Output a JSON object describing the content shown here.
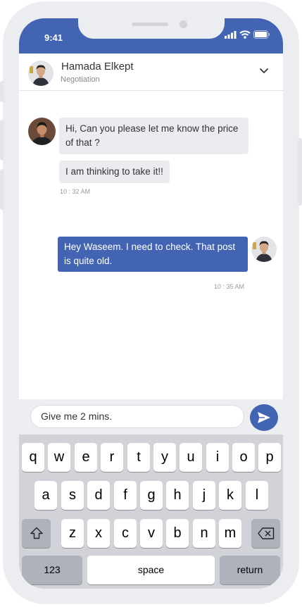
{
  "status_bar": {
    "time": "9:41"
  },
  "header": {
    "contact_name": "Hamada Elkept",
    "subtitle": "Negotiation"
  },
  "messages": [
    {
      "text": "Hi, Can you please let me know the price of that ?"
    },
    {
      "text": "I am thinking to take it!!"
    },
    {
      "time": "10 : 32 AM"
    },
    {
      "text": "Hey Waseem. I need to check. That post is quite old."
    },
    {
      "time": "10 : 35 AM"
    }
  ],
  "composer": {
    "value": "Give me 2 mins."
  },
  "keyboard": {
    "row1": [
      "q",
      "w",
      "e",
      "r",
      "t",
      "y",
      "u",
      "i",
      "o",
      "p"
    ],
    "row2": [
      "a",
      "s",
      "d",
      "f",
      "g",
      "h",
      "j",
      "k",
      "l"
    ],
    "row3": [
      "z",
      "x",
      "c",
      "v",
      "b",
      "n",
      "m"
    ],
    "numbers_label": "123",
    "space_label": "space",
    "return_label": "return"
  },
  "colors": {
    "accent": "#4364b3",
    "incoming_bubble": "#ececf0"
  }
}
